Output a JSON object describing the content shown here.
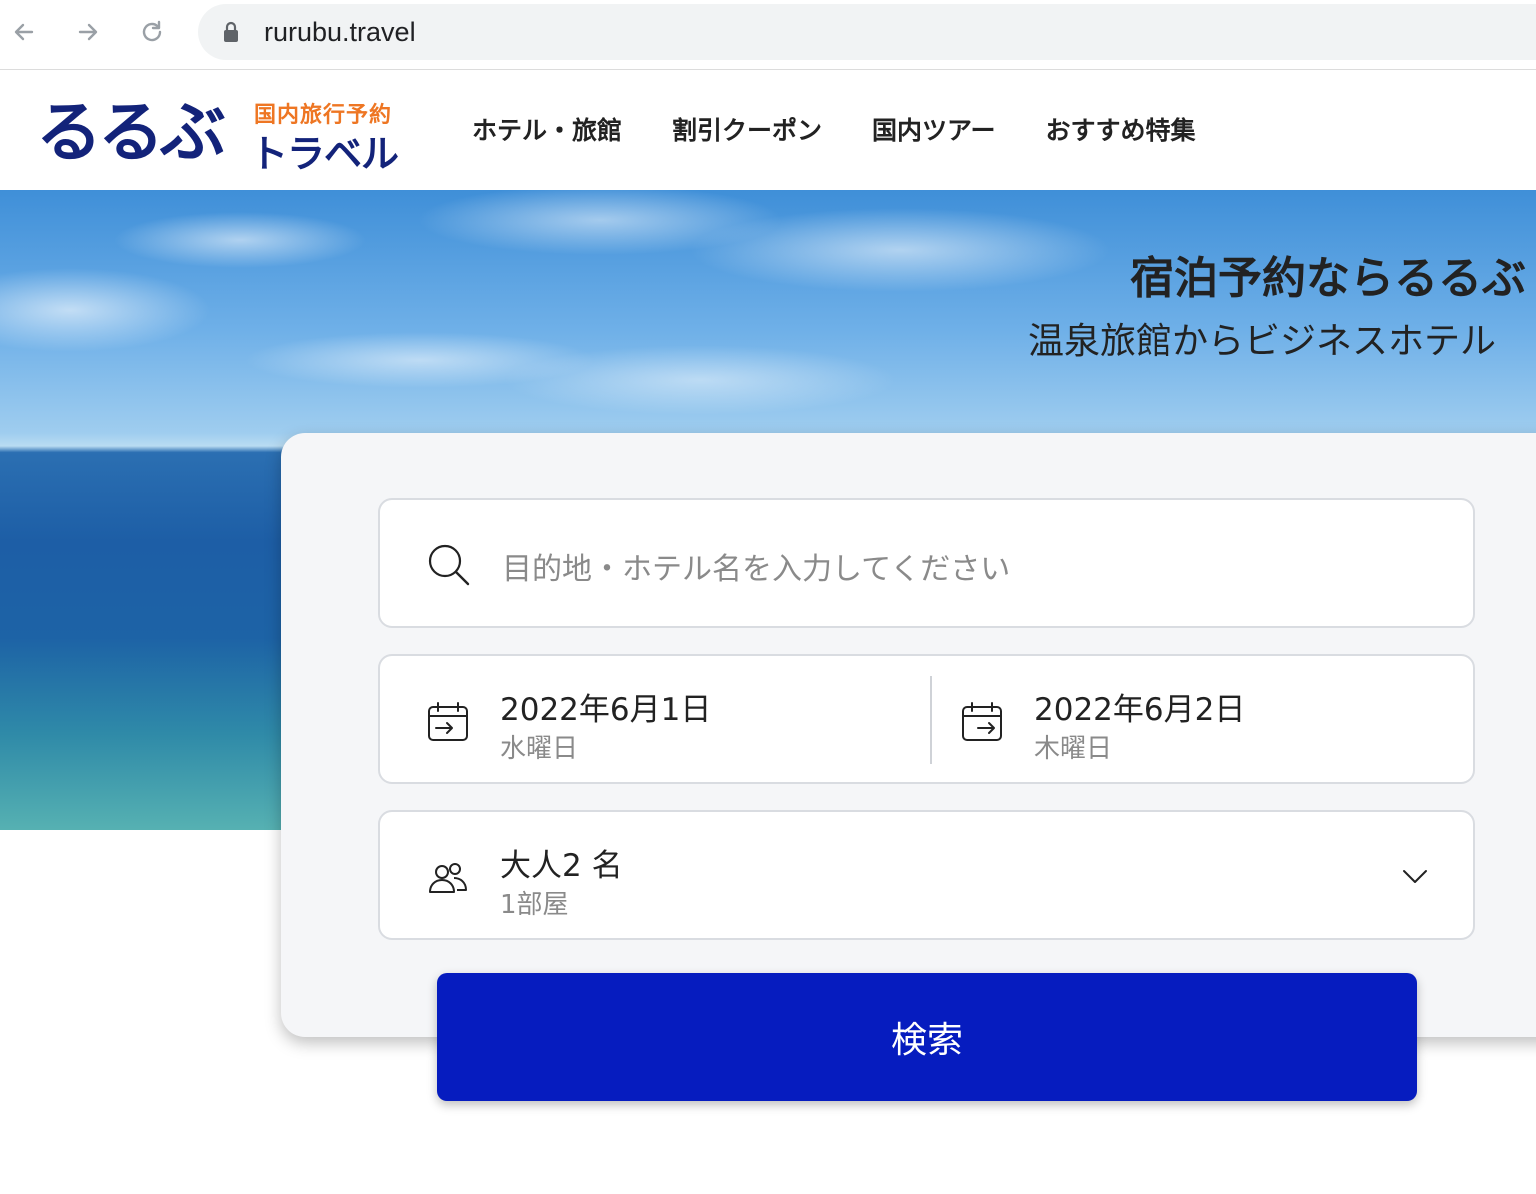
{
  "browser": {
    "url": "rurubu.travel",
    "icons": [
      "back-icon",
      "forward-icon",
      "reload-icon",
      "lock-icon"
    ]
  },
  "header": {
    "logo": {
      "main": "るるぶ",
      "tagline": "国内旅行予約",
      "sub": "トラベル"
    },
    "nav": [
      {
        "label": "ホテル・旅館"
      },
      {
        "label": "割引クーポン"
      },
      {
        "label": "国内ツアー"
      },
      {
        "label": "おすすめ特集"
      }
    ]
  },
  "hero": {
    "title": "宿泊予約ならるるぶ",
    "subtitle": "温泉旅館からビジネスホテル"
  },
  "search": {
    "destination_placeholder": "目的地・ホテル名を入力してください",
    "checkin": {
      "date": "2022年6月1日",
      "weekday": "水曜日"
    },
    "checkout": {
      "date": "2022年6月2日",
      "weekday": "木曜日"
    },
    "guests": {
      "label": "大人2 名",
      "rooms": "1部屋"
    },
    "button": "検索"
  },
  "colors": {
    "brand_navy": "#13237a",
    "brand_orange": "#ee7623",
    "search_button": "#061cbf"
  }
}
